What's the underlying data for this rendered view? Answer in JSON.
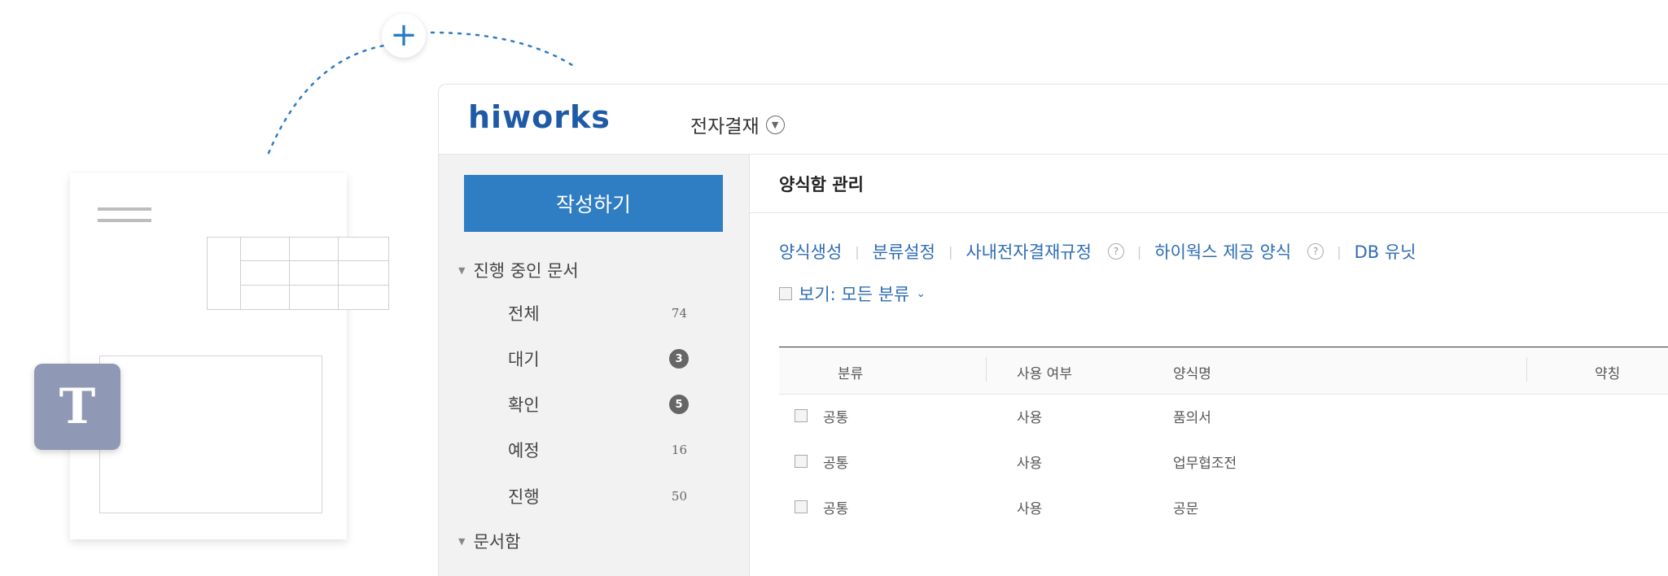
{
  "app": {
    "logo": "hiworks",
    "menu_label": "전자결재"
  },
  "sidebar": {
    "write_button": "작성하기",
    "section_inprogress": "진행 중인 문서",
    "items": [
      {
        "label": "전체",
        "count": "74"
      },
      {
        "label": "대기",
        "count": "3"
      },
      {
        "label": "확인",
        "count": "5"
      },
      {
        "label": "예정",
        "count": "16"
      },
      {
        "label": "진행",
        "count": "50"
      }
    ],
    "section_docbox": "문서함"
  },
  "main": {
    "title": "양식함 관리",
    "links": [
      "양식생성",
      "분류설정",
      "사내전자결재규정",
      "하이웍스 제공 양식",
      "DB 유닛"
    ],
    "help_icon": "?",
    "view_filter": "보기: 모든 분류",
    "table": {
      "headers": [
        "분류",
        "사용 여부",
        "양식명",
        "약칭"
      ],
      "rows": [
        {
          "category": "공통",
          "usage": "사용",
          "name": "품의서"
        },
        {
          "category": "공통",
          "usage": "사용",
          "name": "업무협조전"
        },
        {
          "category": "공통",
          "usage": "사용",
          "name": "공문"
        }
      ]
    }
  },
  "decor": {
    "text_tool_letter": "T",
    "plus": "+"
  },
  "colors": {
    "brand": "#1f5aa6",
    "primary_button": "#2f7ec4",
    "link": "#2f6db5",
    "text_tool": "#8f98b5"
  }
}
